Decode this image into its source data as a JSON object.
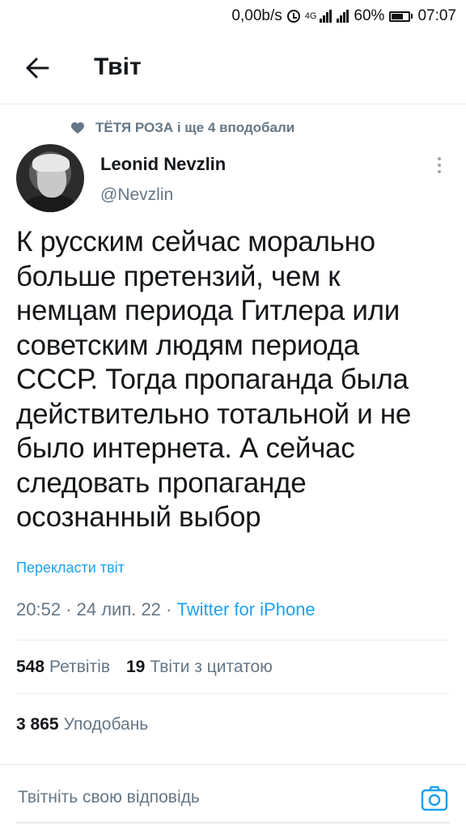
{
  "status_bar": {
    "speed": "0,00b/s",
    "network_type": "4G",
    "battery": "60%",
    "time": "07:07"
  },
  "header": {
    "back_icon": "arrow-left-icon",
    "title": "Твіт"
  },
  "social_context": {
    "icon": "heart-icon",
    "text": "ТЁТЯ РОЗА і ще 4 вподобали"
  },
  "author": {
    "name": "Leonid Nevzlin",
    "handle": "@Nevzlin"
  },
  "tweet": {
    "text": "К русским сейчас морально\nбольше претензий, чем к\nнемцам периода Гитлера или\nсоветским людям периода\nСССР. Тогда пропаганда была\nдействительно тотальной и не\nбыло интернета. А сейчас\nследовать пропаганде\nосознанный выбор",
    "translate_label": "Перекласти твіт",
    "timestamp": "20:52 · 24 лип. 22 · ",
    "source": "Twitter for iPhone"
  },
  "stats": {
    "retweets_count": "548",
    "retweets_label": "Ретвітів",
    "quotes_count": "19",
    "quotes_label": "Твіти з цитатою",
    "likes_count": "3 865",
    "likes_label": "Уподобань"
  },
  "reply": {
    "placeholder": "Твітніть свою відповідь",
    "camera_icon": "camera-icon"
  },
  "colors": {
    "accent": "#1da1f2",
    "secondary_text": "#657786",
    "primary_text": "#14171a"
  }
}
